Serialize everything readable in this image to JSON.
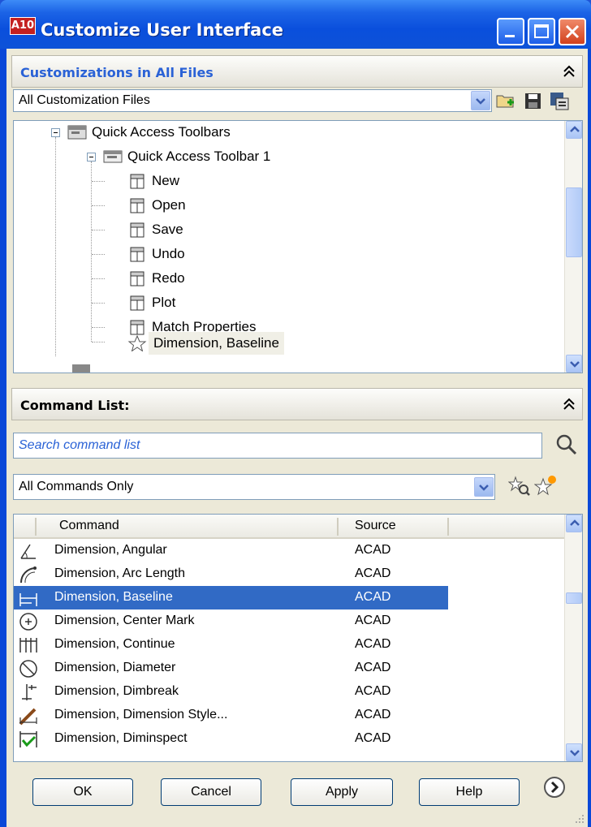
{
  "window": {
    "app_badge": "A10",
    "title": "Customize User Interface"
  },
  "customizations": {
    "header": "Customizations in All Files",
    "file_combo": "All Customization Files",
    "tree": [
      {
        "label": "Quick Access Toolbars",
        "level": 0
      },
      {
        "label": "Quick Access Toolbar 1",
        "level": 1
      },
      {
        "label": "New",
        "level": 2
      },
      {
        "label": "Open",
        "level": 2
      },
      {
        "label": "Save",
        "level": 2
      },
      {
        "label": "Undo",
        "level": 2
      },
      {
        "label": "Redo",
        "level": 2
      },
      {
        "label": "Plot",
        "level": 2
      },
      {
        "label": "Match Properties",
        "level": 2
      },
      {
        "label": "Dimension, Baseline",
        "level": 2
      }
    ]
  },
  "command_list": {
    "header": "Command List:",
    "search_placeholder": "Search command list",
    "filter_combo": "All Commands Only",
    "columns": {
      "command": "Command",
      "source": "Source"
    },
    "rows": [
      {
        "command": "Dimension, Angular",
        "source": "ACAD"
      },
      {
        "command": "Dimension, Arc Length",
        "source": "ACAD"
      },
      {
        "command": "Dimension, Baseline",
        "source": "ACAD"
      },
      {
        "command": "Dimension, Center Mark",
        "source": "ACAD"
      },
      {
        "command": "Dimension, Continue",
        "source": "ACAD"
      },
      {
        "command": "Dimension, Diameter",
        "source": "ACAD"
      },
      {
        "command": "Dimension, Dimbreak",
        "source": "ACAD"
      },
      {
        "command": "Dimension, Dimension Style...",
        "source": "ACAD"
      },
      {
        "command": "Dimension, Diminspect",
        "source": "ACAD"
      }
    ]
  },
  "buttons": {
    "ok": "OK",
    "cancel": "Cancel",
    "apply": "Apply",
    "help": "Help"
  },
  "colors": {
    "title_bar": "#0a4fdc",
    "section_header_text": "#2a62d6",
    "selection": "#316ac5"
  }
}
